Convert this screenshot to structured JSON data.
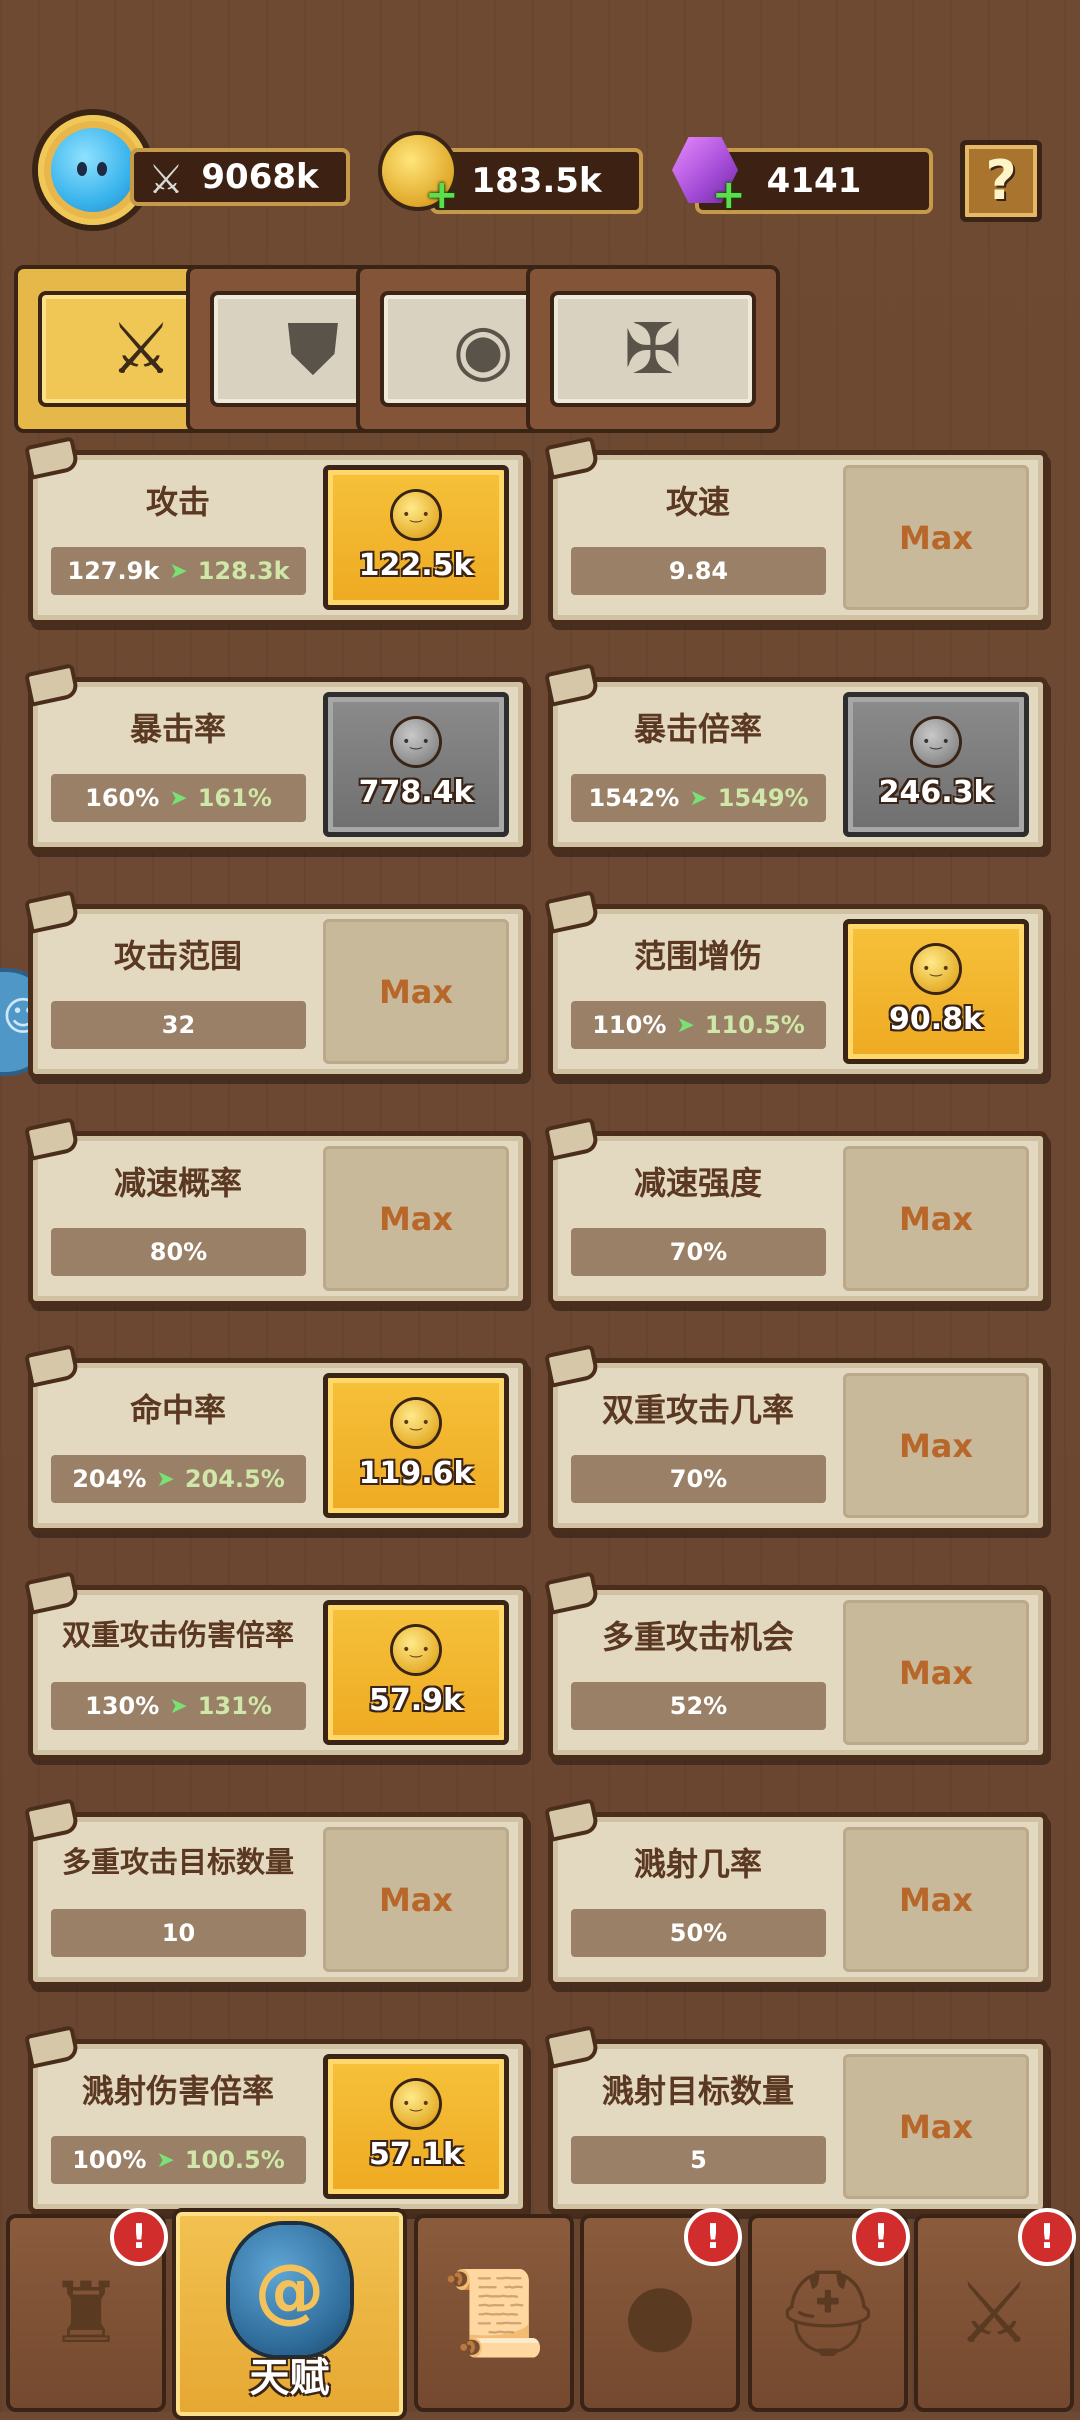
{
  "resources": {
    "power": "9068k",
    "gold": "183.5k",
    "gems": "4141",
    "help_label": "?"
  },
  "tabs": [
    {
      "icon": "crossed-swords-icon",
      "glyph": "⚔",
      "active": true
    },
    {
      "icon": "shield-icon",
      "glyph": "⛊",
      "active": false
    },
    {
      "icon": "slime-emblem-icon",
      "glyph": "◉",
      "active": false
    },
    {
      "icon": "winged-sword-icon",
      "glyph": "✠",
      "active": false
    }
  ],
  "cards": [
    {
      "name": "攻击",
      "current": "127.9k",
      "next": "128.3k",
      "type": "gold",
      "price": "122.5k"
    },
    {
      "name": "攻速",
      "current": "9.84",
      "next": null,
      "type": "max",
      "price": "Max"
    },
    {
      "name": "暴击率",
      "current": "160%",
      "next": "161%",
      "type": "grey",
      "price": "778.4k"
    },
    {
      "name": "暴击倍率",
      "current": "1542%",
      "next": "1549%",
      "type": "grey",
      "price": "246.3k"
    },
    {
      "name": "攻击范围",
      "current": "32",
      "next": null,
      "type": "max",
      "price": "Max"
    },
    {
      "name": "范围增伤",
      "current": "110%",
      "next": "110.5%",
      "type": "gold",
      "price": "90.8k"
    },
    {
      "name": "减速概率",
      "current": "80%",
      "next": null,
      "type": "max",
      "price": "Max"
    },
    {
      "name": "减速强度",
      "current": "70%",
      "next": null,
      "type": "max",
      "price": "Max"
    },
    {
      "name": "命中率",
      "current": "204%",
      "next": "204.5%",
      "type": "gold",
      "price": "119.6k"
    },
    {
      "name": "双重攻击几率",
      "current": "70%",
      "next": null,
      "type": "max",
      "price": "Max"
    },
    {
      "name": "双重攻击伤害倍率",
      "current": "130%",
      "next": "131%",
      "type": "gold",
      "price": "57.9k"
    },
    {
      "name": "多重攻击机会",
      "current": "52%",
      "next": null,
      "type": "max",
      "price": "Max"
    },
    {
      "name": "多重攻击目标数量",
      "current": "10",
      "next": null,
      "type": "max",
      "price": "Max"
    },
    {
      "name": "溅射几率",
      "current": "50%",
      "next": null,
      "type": "max",
      "price": "Max"
    },
    {
      "name": "溅射伤害倍率",
      "current": "100%",
      "next": "100.5%",
      "type": "gold",
      "price": "57.1k"
    },
    {
      "name": "溅射目标数量",
      "current": "5",
      "next": null,
      "type": "max",
      "price": "Max"
    }
  ],
  "bottom_nav": [
    {
      "icon": "hero-statue-icon",
      "glyph": "♜",
      "label": "",
      "alert": true,
      "active": false
    },
    {
      "icon": "talent-rune-icon",
      "glyph": "@",
      "label": "天赋",
      "alert": false,
      "active": true
    },
    {
      "icon": "scroll-sword-icon",
      "glyph": "📜",
      "label": "",
      "alert": false,
      "active": false
    },
    {
      "icon": "blue-slime-icon",
      "glyph": "●",
      "label": "",
      "alert": true,
      "active": false
    },
    {
      "icon": "knight-helmet-icon",
      "glyph": "⛑",
      "label": "",
      "alert": true,
      "active": false
    },
    {
      "icon": "crossed-swords-icon",
      "glyph": "⚔",
      "label": "",
      "alert": true,
      "active": false
    }
  ],
  "alert_glyph": "!",
  "colors": {
    "gold_button": "#f2b633",
    "grey_button": "#7d7d7d",
    "max_text": "#b8672a",
    "wood": "#6e4a34"
  }
}
